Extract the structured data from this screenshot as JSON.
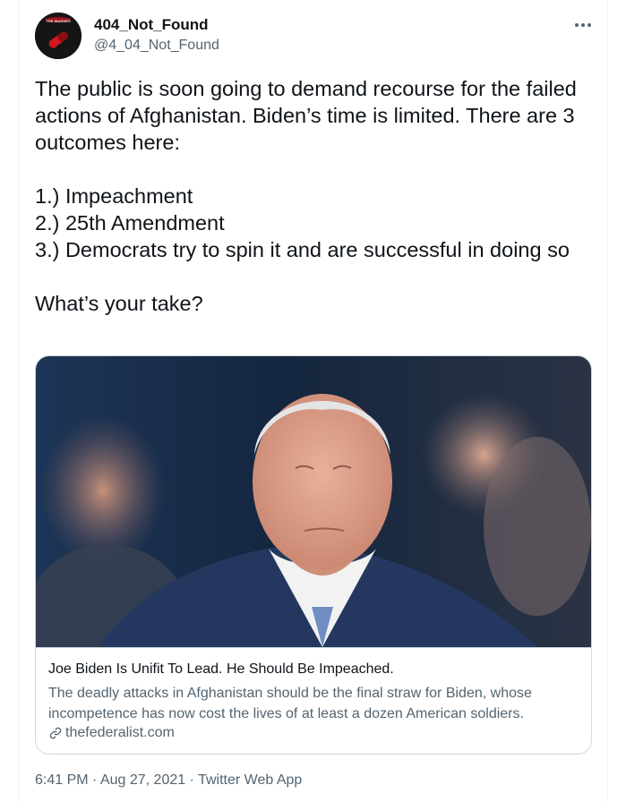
{
  "tweet": {
    "display_name": "404_Not_Found",
    "handle": "@4_04_Not_Found",
    "avatar_caption": "THE MASSES",
    "text_lines": [
      "The public is soon going to demand recourse for the failed actions of Afghanistan. Biden’s time is limited. There are 3 outcomes here:",
      "1.) Impeachment",
      "2.) 25th Amendment",
      "3.) Democrats try to spin it and are successful in doing so",
      "What’s your take?"
    ],
    "time": "6:41 PM",
    "date": "Aug 27, 2021",
    "source": "Twitter Web App",
    "separator": "·"
  },
  "card": {
    "title": "Joe Biden Is Unifit To Lead. He Should Be Impeached.",
    "description": "The deadly attacks in Afghanistan should be the final straw for Biden, whose incompetence has now cost the lives of at least a dozen American soldiers.",
    "domain": "thefederalist.com"
  },
  "colors": {
    "text_primary": "#0f1419",
    "text_secondary": "#536471",
    "border": "#cfd9de"
  },
  "icons": {
    "more": "more-horizontal-icon",
    "link": "link-icon"
  }
}
